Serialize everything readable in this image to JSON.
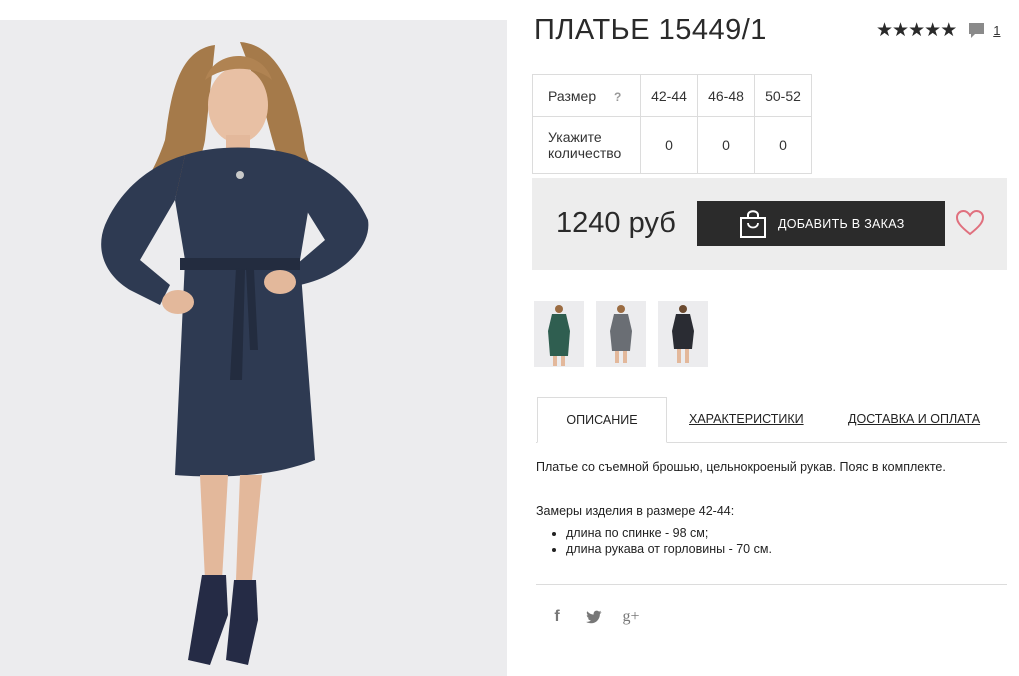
{
  "product": {
    "title": "ПЛАТЬЕ 15449/1",
    "rating_stars": 5,
    "comment_count": "1",
    "main_image_icon": "dress-model-photo"
  },
  "sizes": {
    "size_label": "Размер",
    "help_label": "?",
    "quantity_label_line1": "Укажите",
    "quantity_label_line2": "количество",
    "columns": [
      {
        "size": "42-44",
        "qty": "0"
      },
      {
        "size": "46-48",
        "qty": "0"
      },
      {
        "size": "50-52",
        "qty": "0"
      }
    ]
  },
  "buy": {
    "price": "1240 руб",
    "add_button_label": "ДОБАВИТЬ В ЗАКАЗ",
    "bag_icon": "shopping-bag-icon",
    "wishlist_icon": "heart-icon"
  },
  "thumbnails": [
    {
      "icon": "thumbnail-green-dress",
      "color": "#2f5e50"
    },
    {
      "icon": "thumbnail-gray-dress",
      "color": "#6a6e74"
    },
    {
      "icon": "thumbnail-black-dress",
      "color": "#2a2c33"
    }
  ],
  "tabs": {
    "description": "ОПИСАНИЕ",
    "characteristics": "ХАРАКТЕРИСТИКИ",
    "delivery": "ДОСТАВКА И ОПЛАТА"
  },
  "description": {
    "text": "Платье со съемной брошью, цельнокроеный рукав. Пояс в комплекте.",
    "measurements_title": "Замеры изделия в размере 42-44:",
    "measurements": [
      "длина по спинке - 98 см;",
      "длина рукава от горловины - 70 см."
    ]
  },
  "social": {
    "facebook": "f",
    "twitter": "twitter-icon",
    "googleplus": "g+"
  },
  "colors": {
    "dark": "#2b2b2b",
    "bar_bg": "#ededed",
    "heart": "#e0707e",
    "dress": "#2e3a52"
  }
}
